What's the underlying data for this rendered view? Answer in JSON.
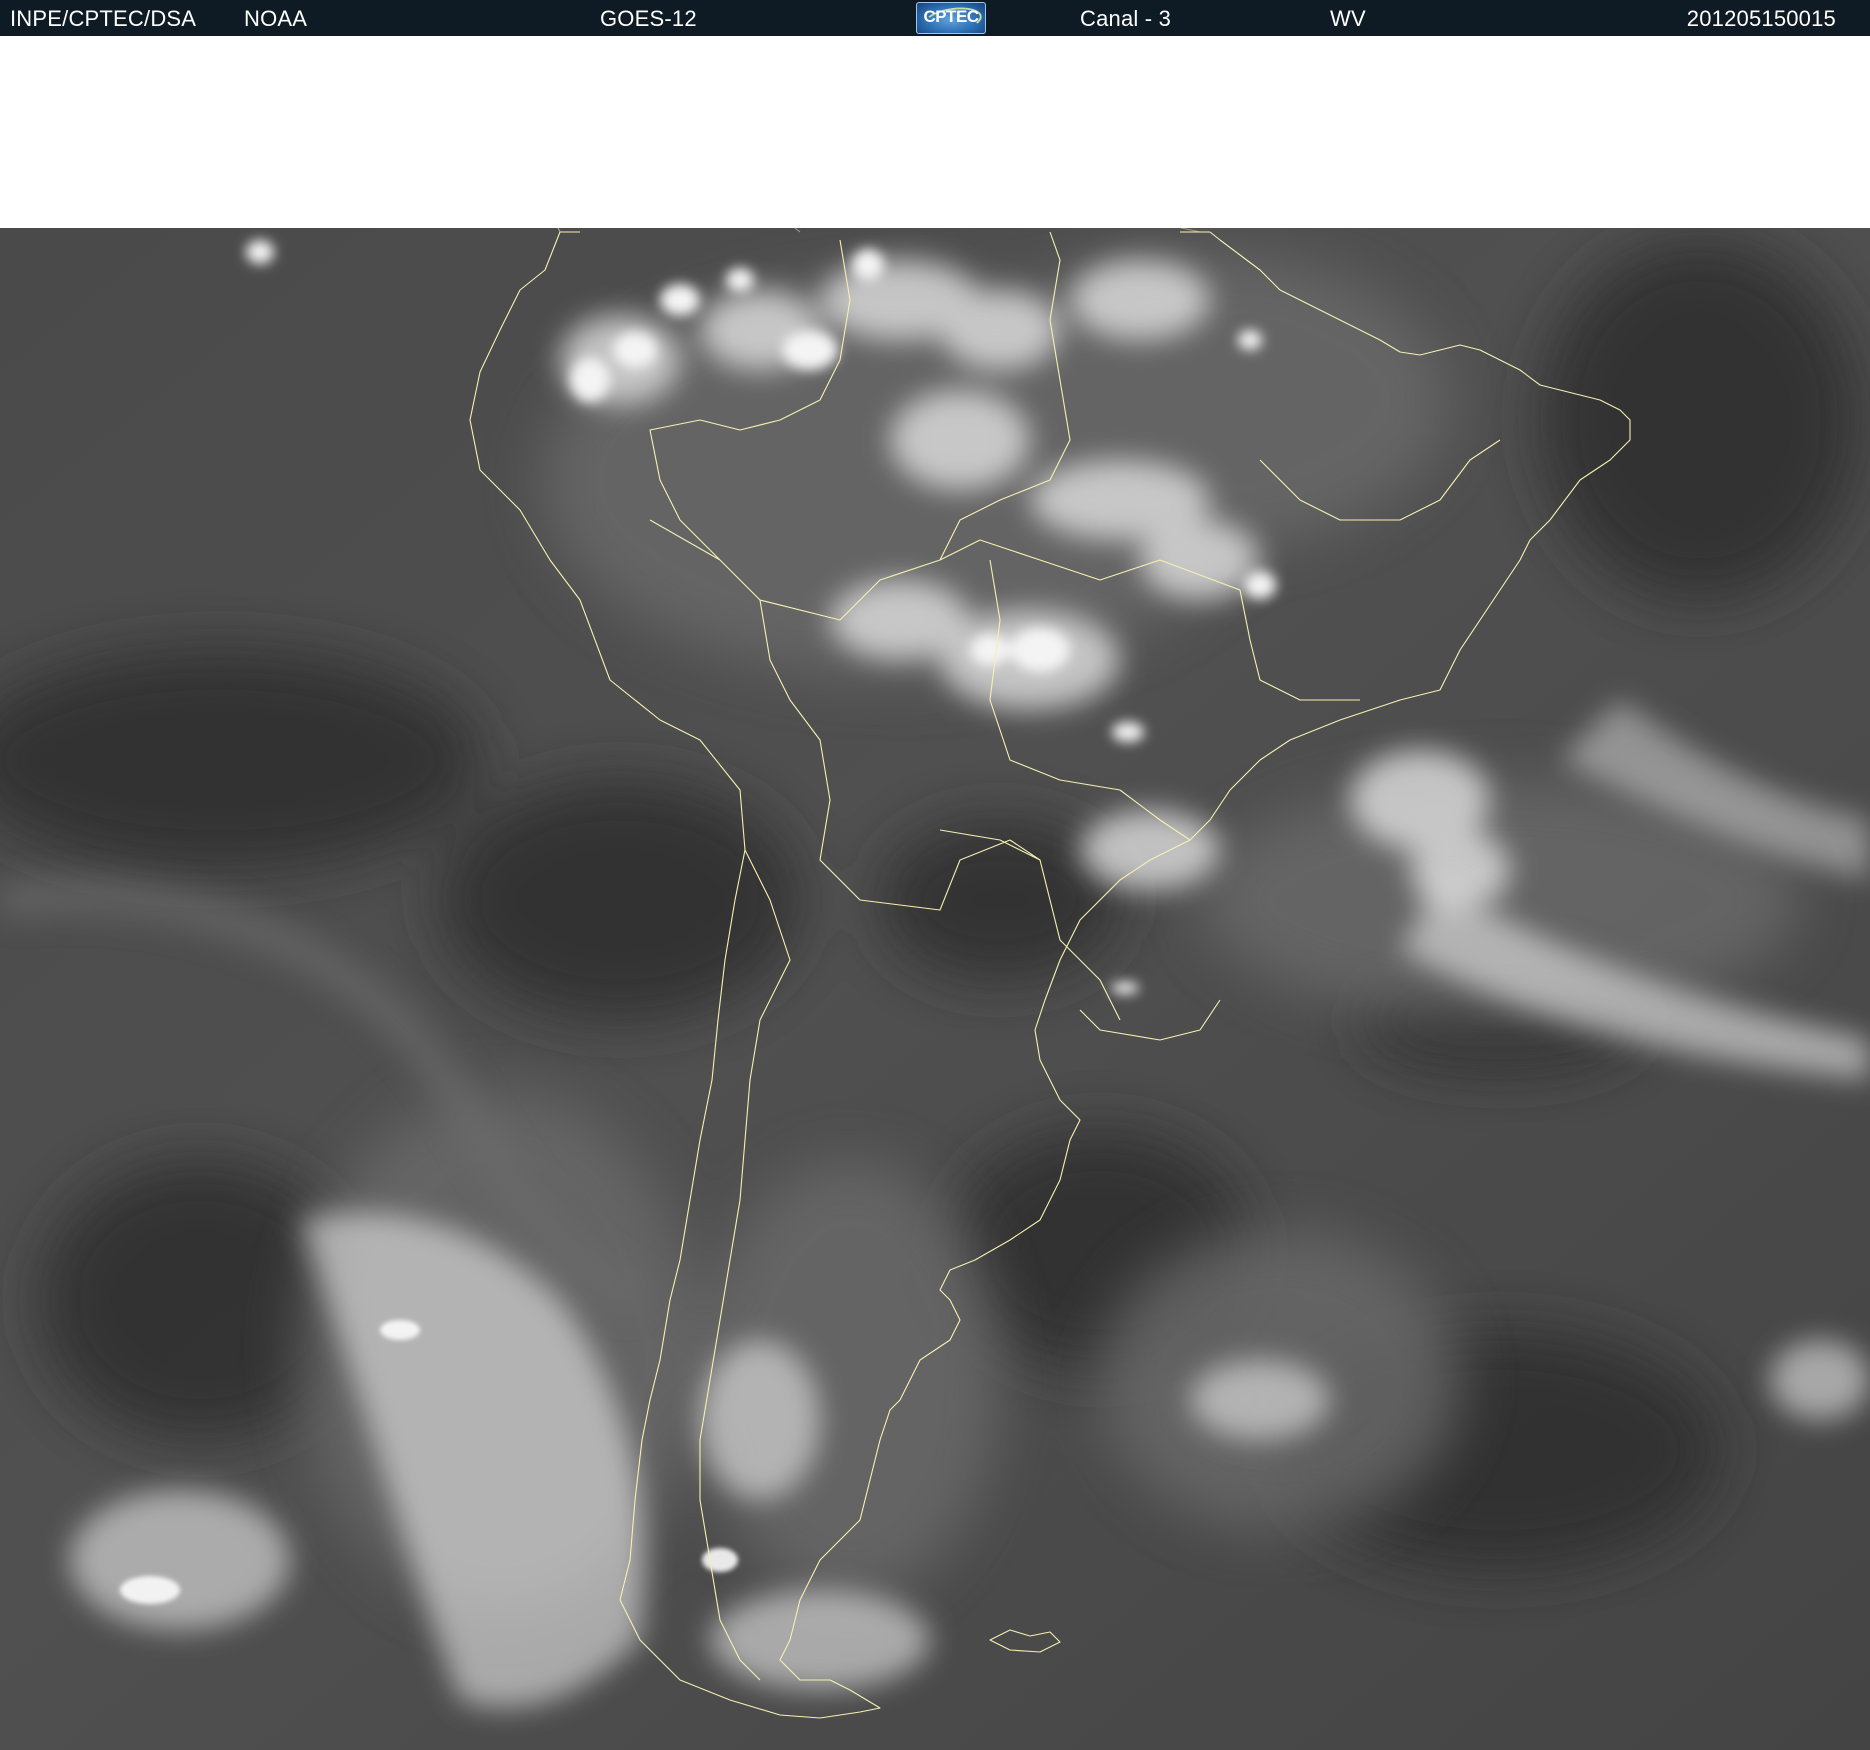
{
  "header": {
    "source": "INPE/CPTEC/DSA",
    "agency": "NOAA",
    "satellite": "GOES-12",
    "logo_text": "CPTEC",
    "channel": "Canal - 3",
    "band": "WV",
    "timestamp": "201205150015"
  },
  "image": {
    "kind": "water-vapor satellite image of South America",
    "overlay_color": "#f5f0b0",
    "background_color": "#505050"
  }
}
